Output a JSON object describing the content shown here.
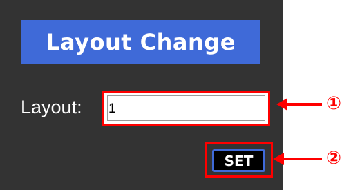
{
  "panel": {
    "title": "Layout Change",
    "layout_label": "Layout:",
    "layout_value": "1",
    "set_label": "SET"
  },
  "annotations": {
    "marker_1": "①",
    "marker_2": "②",
    "highlight_color": "#ff0000"
  },
  "colors": {
    "panel_bg": "#333333",
    "title_bg": "#3f6ad8",
    "button_border": "#3f6ad8"
  }
}
